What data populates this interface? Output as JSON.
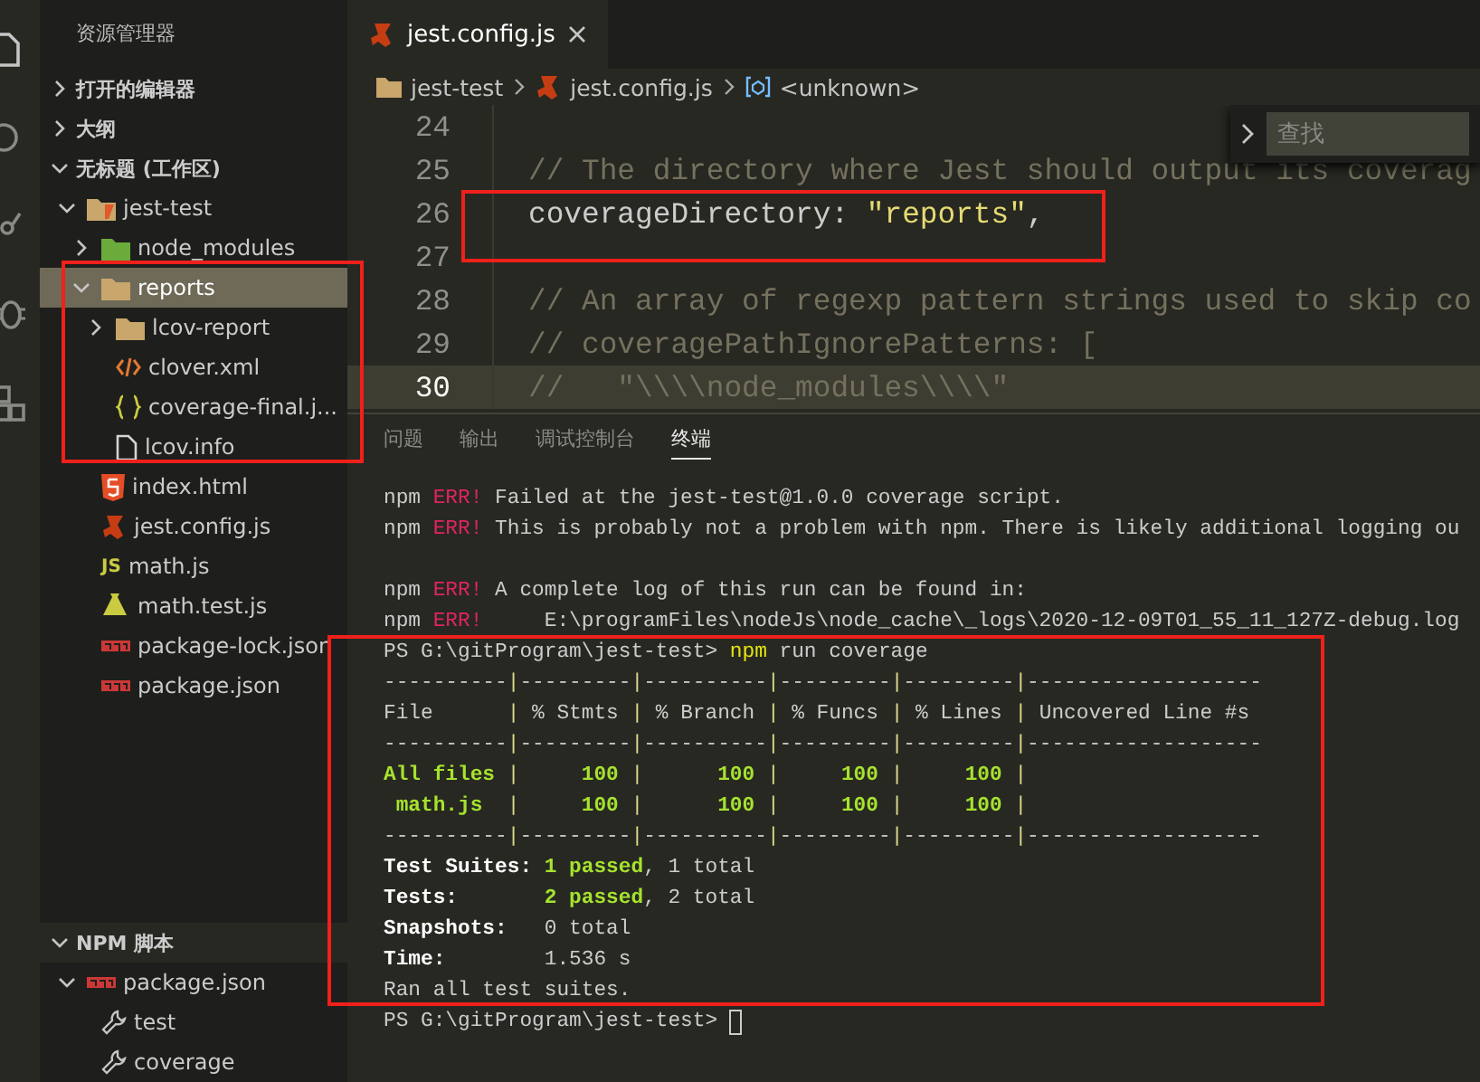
{
  "sidebar": {
    "title": "资源管理器",
    "sections": [
      {
        "title": "打开的编辑器",
        "expanded": false
      },
      {
        "title": "大纲",
        "expanded": false
      },
      {
        "title": "无标题 (工作区)",
        "expanded": true,
        "tree": [
          {
            "label": "jest-test",
            "kind": "folder-root",
            "expanded": true,
            "selected": false,
            "children": [
              {
                "label": "node_modules",
                "kind": "folder-node",
                "expanded": false,
                "selected": false
              },
              {
                "label": "reports",
                "kind": "folder",
                "expanded": true,
                "selected": true,
                "children": [
                  {
                    "label": "lcov-report",
                    "kind": "folder",
                    "expanded": false,
                    "selected": false
                  },
                  {
                    "label": "clover.xml",
                    "kind": "xml",
                    "selected": false
                  },
                  {
                    "label": "coverage-final.j...",
                    "kind": "json",
                    "selected": false
                  },
                  {
                    "label": "lcov.info",
                    "kind": "file",
                    "selected": false
                  }
                ]
              },
              {
                "label": "index.html",
                "kind": "html",
                "selected": false
              },
              {
                "label": "jest.config.js",
                "kind": "jest",
                "selected": false
              },
              {
                "label": "math.js",
                "kind": "js",
                "icon_text": "JS",
                "selected": false
              },
              {
                "label": "math.test.js",
                "kind": "test",
                "selected": false
              },
              {
                "label": "package-lock.json",
                "kind": "npm",
                "selected": false
              },
              {
                "label": "package.json",
                "kind": "npm",
                "selected": false
              }
            ]
          }
        ]
      }
    ],
    "bottom_section": {
      "title": "NPM 脚本",
      "expanded": true,
      "tree": [
        {
          "label": "package.json",
          "kind": "npm",
          "expanded": true,
          "selected": false,
          "children": [
            {
              "label": "test",
              "kind": "script",
              "selected": false
            },
            {
              "label": "coverage",
              "kind": "script",
              "selected": false
            }
          ]
        }
      ]
    }
  },
  "editor": {
    "tabs": [
      {
        "label": "jest.config.js",
        "kind": "jest",
        "selected": true
      }
    ],
    "breadcrumb": [
      {
        "label": "jest-test",
        "kind": "folder-root"
      },
      {
        "label": "jest.config.js",
        "kind": "jest"
      },
      {
        "label": "<unknown>",
        "kind": "symbol"
      }
    ],
    "find": {
      "placeholder": "查找"
    },
    "lines": [
      {
        "number": "24",
        "current": false
      },
      {
        "number": "25",
        "current": false,
        "segments": [
          {
            "kind": "comment",
            "text": "// The directory where Jest should output its coverag"
          }
        ]
      },
      {
        "number": "26",
        "current": false,
        "segments": [
          {
            "kind": "plain",
            "text": "coverageDirectory: "
          },
          {
            "kind": "string",
            "text": "\"reports\""
          },
          {
            "kind": "plain",
            "text": ","
          }
        ]
      },
      {
        "number": "27",
        "current": false
      },
      {
        "number": "28",
        "current": false,
        "segments": [
          {
            "kind": "comment",
            "text": "// An array of regexp pattern strings used to skip co"
          }
        ]
      },
      {
        "number": "29",
        "current": false,
        "segments": [
          {
            "kind": "comment",
            "text": "// coveragePathIgnorePatterns: ["
          }
        ]
      },
      {
        "number": "30",
        "current": true,
        "segments": [
          {
            "kind": "comment",
            "text": "//   \"\\\\\\\\node_modules\\\\\\\\\""
          }
        ]
      }
    ]
  },
  "panel": {
    "tabs": [
      {
        "label": "问题",
        "selected": false
      },
      {
        "label": "输出",
        "selected": false
      },
      {
        "label": "调试控制台",
        "selected": false
      },
      {
        "label": "终端",
        "selected": true
      }
    ],
    "terminal": [
      {
        "kind": "text",
        "segments": [
          {
            "kind": "plain",
            "text": "npm "
          },
          {
            "kind": "err",
            "text": "ERR!"
          },
          {
            "kind": "plain",
            "text": " Failed at the jest-test@1.0.0 coverage script."
          }
        ]
      },
      {
        "kind": "text",
        "segments": [
          {
            "kind": "plain",
            "text": "npm "
          },
          {
            "kind": "err",
            "text": "ERR!"
          },
          {
            "kind": "plain",
            "text": " This is probably not a problem with npm. There is likely additional logging ou"
          }
        ]
      },
      {
        "kind": "blank"
      },
      {
        "kind": "text",
        "segments": [
          {
            "kind": "plain",
            "text": "npm "
          },
          {
            "kind": "err",
            "text": "ERR!"
          },
          {
            "kind": "plain",
            "text": " A complete log of this run can be found in:"
          }
        ]
      },
      {
        "kind": "text",
        "segments": [
          {
            "kind": "plain",
            "text": "npm "
          },
          {
            "kind": "err",
            "text": "ERR!"
          },
          {
            "kind": "plain",
            "text": "     E:\\programFiles\\nodeJs\\node_cache\\_logs\\2020-12-09T01_55_11_127Z-debug.log"
          }
        ]
      },
      {
        "kind": "text",
        "segments": [
          {
            "kind": "plain",
            "text": "PS G:\\gitProgram\\jest-test> "
          },
          {
            "kind": "cmd",
            "text": "npm"
          },
          {
            "kind": "plain",
            "text": " run coverage"
          }
        ]
      },
      {
        "kind": "text",
        "segments": [
          {
            "kind": "plain",
            "text": "----------"
          },
          {
            "kind": "pipe",
            "text": "|"
          },
          {
            "kind": "plain",
            "text": "---------"
          },
          {
            "kind": "pipe",
            "text": "|"
          },
          {
            "kind": "plain",
            "text": "----------"
          },
          {
            "kind": "pipe",
            "text": "|"
          },
          {
            "kind": "plain",
            "text": "---------"
          },
          {
            "kind": "pipe",
            "text": "|"
          },
          {
            "kind": "plain",
            "text": "---------"
          },
          {
            "kind": "pipe",
            "text": "|"
          },
          {
            "kind": "plain",
            "text": "-------------------"
          }
        ]
      },
      {
        "kind": "text",
        "segments": [
          {
            "kind": "plain",
            "text": "File      "
          },
          {
            "kind": "pipe",
            "text": "|"
          },
          {
            "kind": "plain",
            "text": " % Stmts "
          },
          {
            "kind": "pipe",
            "text": "|"
          },
          {
            "kind": "plain",
            "text": " % Branch "
          },
          {
            "kind": "pipe",
            "text": "|"
          },
          {
            "kind": "plain",
            "text": " % Funcs "
          },
          {
            "kind": "pipe",
            "text": "|"
          },
          {
            "kind": "plain",
            "text": " % Lines "
          },
          {
            "kind": "pipe",
            "text": "|"
          },
          {
            "kind": "plain",
            "text": " Uncovered Line #s"
          }
        ]
      },
      {
        "kind": "text",
        "segments": [
          {
            "kind": "plain",
            "text": "----------"
          },
          {
            "kind": "pipe",
            "text": "|"
          },
          {
            "kind": "plain",
            "text": "---------"
          },
          {
            "kind": "pipe",
            "text": "|"
          },
          {
            "kind": "plain",
            "text": "----------"
          },
          {
            "kind": "pipe",
            "text": "|"
          },
          {
            "kind": "plain",
            "text": "---------"
          },
          {
            "kind": "pipe",
            "text": "|"
          },
          {
            "kind": "plain",
            "text": "---------"
          },
          {
            "kind": "pipe",
            "text": "|"
          },
          {
            "kind": "plain",
            "text": "-------------------"
          }
        ]
      },
      {
        "kind": "text",
        "segments": [
          {
            "kind": "pass",
            "text": "All files "
          },
          {
            "kind": "pipe",
            "text": "|"
          },
          {
            "kind": "pass",
            "text": "     100 "
          },
          {
            "kind": "pipe",
            "text": "|"
          },
          {
            "kind": "pass",
            "text": "      100 "
          },
          {
            "kind": "pipe",
            "text": "|"
          },
          {
            "kind": "pass",
            "text": "     100 "
          },
          {
            "kind": "pipe",
            "text": "|"
          },
          {
            "kind": "pass",
            "text": "     100 "
          },
          {
            "kind": "pipe",
            "text": "|"
          }
        ]
      },
      {
        "kind": "text",
        "segments": [
          {
            "kind": "pass",
            "text": " math.js  "
          },
          {
            "kind": "pipe",
            "text": "|"
          },
          {
            "kind": "pass",
            "text": "     100 "
          },
          {
            "kind": "pipe",
            "text": "|"
          },
          {
            "kind": "pass",
            "text": "      100 "
          },
          {
            "kind": "pipe",
            "text": "|"
          },
          {
            "kind": "pass",
            "text": "     100 "
          },
          {
            "kind": "pipe",
            "text": "|"
          },
          {
            "kind": "pass",
            "text": "     100 "
          },
          {
            "kind": "pipe",
            "text": "|"
          }
        ]
      },
      {
        "kind": "text",
        "segments": [
          {
            "kind": "plain",
            "text": "----------"
          },
          {
            "kind": "pipe",
            "text": "|"
          },
          {
            "kind": "plain",
            "text": "---------"
          },
          {
            "kind": "pipe",
            "text": "|"
          },
          {
            "kind": "plain",
            "text": "----------"
          },
          {
            "kind": "pipe",
            "text": "|"
          },
          {
            "kind": "plain",
            "text": "---------"
          },
          {
            "kind": "pipe",
            "text": "|"
          },
          {
            "kind": "plain",
            "text": "---------"
          },
          {
            "kind": "pipe",
            "text": "|"
          },
          {
            "kind": "plain",
            "text": "-------------------"
          }
        ]
      },
      {
        "kind": "text",
        "segments": [
          {
            "kind": "label",
            "text": "Test Suites: "
          },
          {
            "kind": "pass",
            "text": "1 passed"
          },
          {
            "kind": "plain",
            "text": ", 1 total"
          }
        ]
      },
      {
        "kind": "text",
        "segments": [
          {
            "kind": "label",
            "text": "Tests:       "
          },
          {
            "kind": "pass",
            "text": "2 passed"
          },
          {
            "kind": "plain",
            "text": ", 2 total"
          }
        ]
      },
      {
        "kind": "text",
        "segments": [
          {
            "kind": "label",
            "text": "Snapshots:   "
          },
          {
            "kind": "plain",
            "text": "0 total"
          }
        ]
      },
      {
        "kind": "text",
        "segments": [
          {
            "kind": "label",
            "text": "Time:        "
          },
          {
            "kind": "plain",
            "text": "1.536 s"
          }
        ]
      },
      {
        "kind": "text",
        "segments": [
          {
            "kind": "plain",
            "text": "Ran all test suites."
          }
        ]
      },
      {
        "kind": "prompt",
        "segments": [
          {
            "kind": "plain",
            "text": "PS G:\\gitProgram\\jest-test> "
          }
        ]
      }
    ]
  }
}
